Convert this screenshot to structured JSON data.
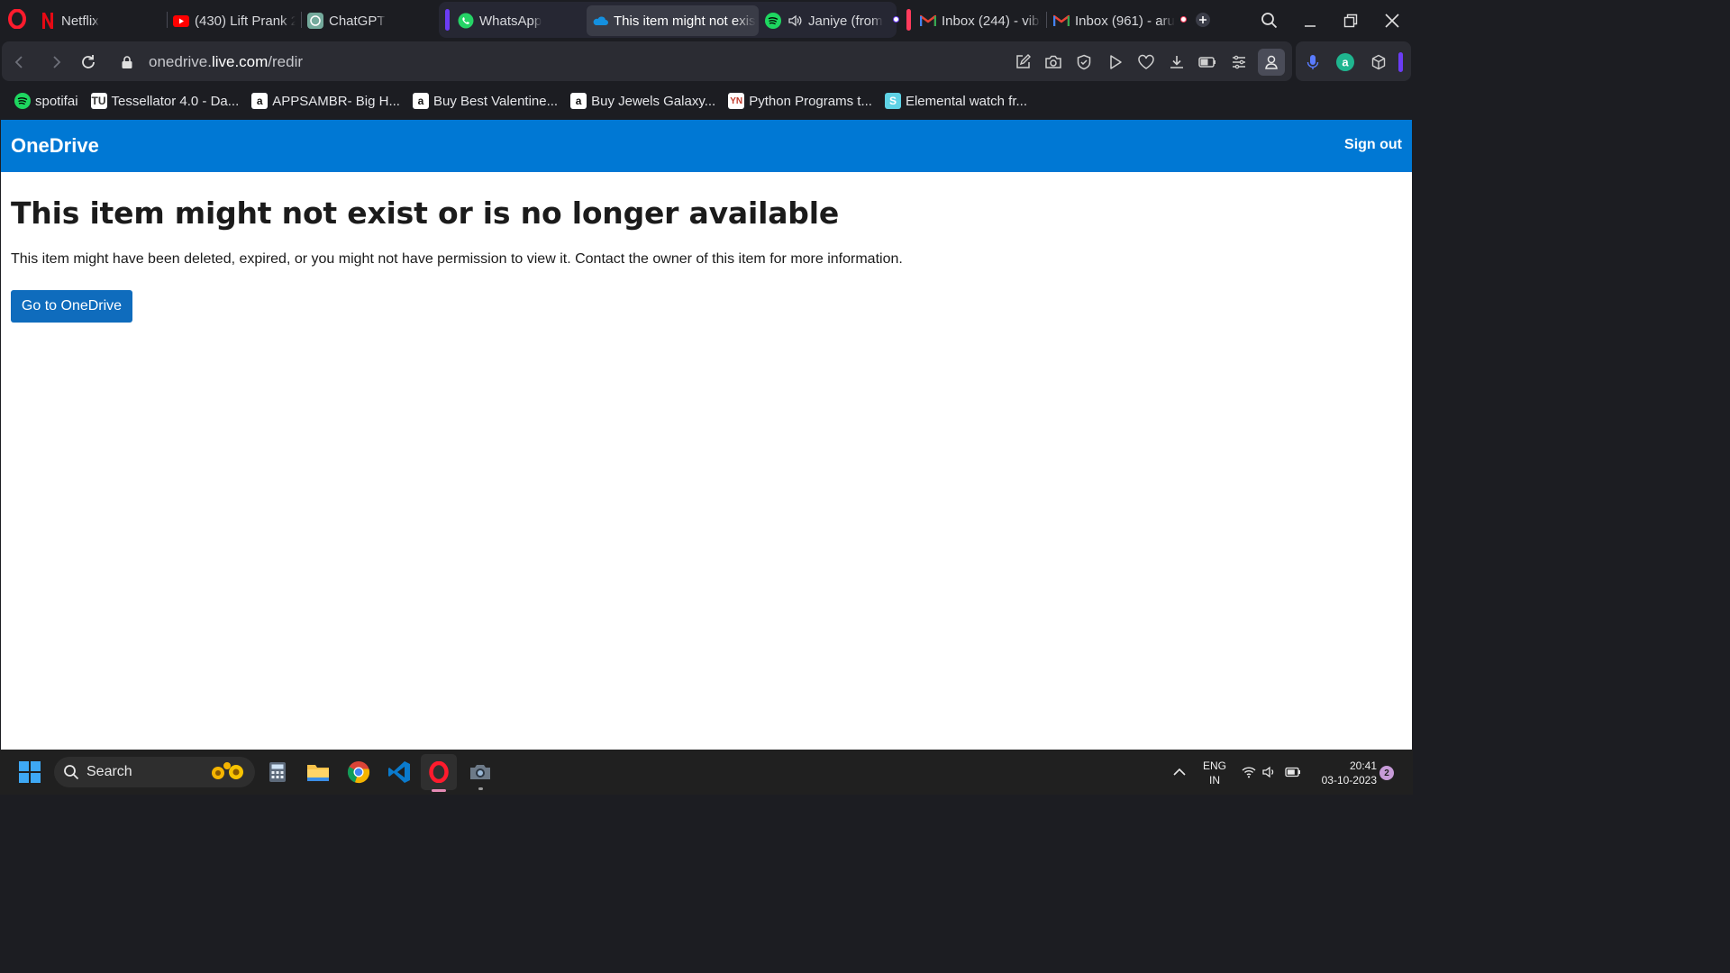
{
  "tabs": [
    {
      "label": "Netflix",
      "icon": "netflix-icon"
    },
    {
      "label": "(430) Lift Prank 2",
      "icon": "youtube-icon"
    },
    {
      "label": "ChatGPT",
      "icon": "chatgpt-icon"
    },
    {
      "label": "WhatsApp",
      "icon": "whatsapp-icon"
    },
    {
      "label": "This item might not exis",
      "icon": "onedrive-icon",
      "active": true
    },
    {
      "label": "Janiye (from",
      "icon": "spotify-icon",
      "audio": true
    },
    {
      "label": "Inbox (244) - vibl",
      "icon": "gmail-icon"
    },
    {
      "label": "Inbox (961) - aru",
      "icon": "gmail-icon"
    }
  ],
  "address": {
    "url_prefix": "onedrive.",
    "url_domain": "live.com",
    "url_suffix": "/redir"
  },
  "bookmarks": [
    {
      "label": "spotifai",
      "icon": "spotify-icon"
    },
    {
      "label": "Tessellator 4.0 - Da...",
      "icon": "tessellator-icon"
    },
    {
      "label": "APPSAMBR- Big H...",
      "icon": "amazon-icon"
    },
    {
      "label": "Buy Best Valentine...",
      "icon": "amazon-icon"
    },
    {
      "label": "Buy Jewels Galaxy...",
      "icon": "amazon-icon"
    },
    {
      "label": "Python Programs t...",
      "icon": "python-site-icon"
    },
    {
      "label": "Elemental watch fr...",
      "icon": "elemental-icon"
    }
  ],
  "page": {
    "brand": "OneDrive",
    "sign_out": "Sign out",
    "title": "This item might not exist or is no longer available",
    "description": "This item might have been deleted, expired, or you might not have permission to view it. Contact the owner of this item for more information.",
    "button": "Go to OneDrive"
  },
  "taskbar": {
    "search_label": "Search",
    "lang_line1": "ENG",
    "lang_line2": "IN",
    "time": "20:41",
    "date": "03-10-2023",
    "notification_count": "2"
  },
  "colors": {
    "onedrive_blue": "#0078d4",
    "button_blue": "#0f6cbd",
    "browser_dark": "#1c1d22"
  }
}
